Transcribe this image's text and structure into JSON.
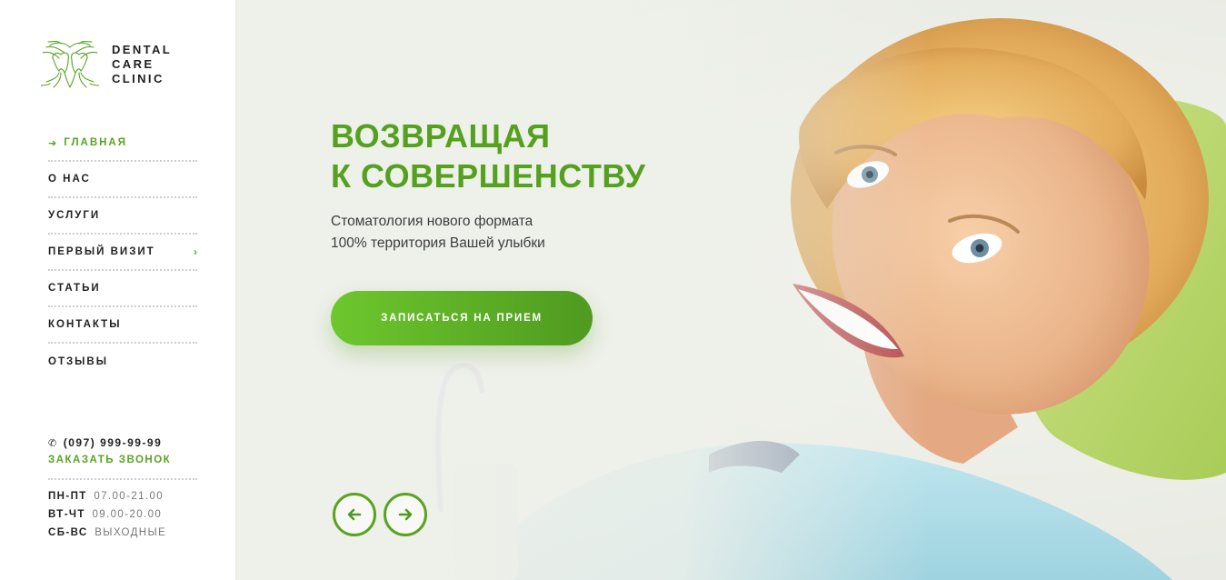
{
  "logo": {
    "line1": "DENTAL",
    "line2": "CARE",
    "line3": "CLINIC",
    "icon": "tree-teeth-logo"
  },
  "nav": {
    "items": [
      {
        "label": "ГЛАВНАЯ",
        "active": true,
        "icon": "arrow-right-icon"
      },
      {
        "label": "О НАС"
      },
      {
        "label": "УСЛУГИ"
      },
      {
        "label": "ПЕРВЫЙ ВИЗИТ",
        "icon": "chevron-right-icon",
        "chevron": "›"
      },
      {
        "label": "СТАТЬИ"
      },
      {
        "label": "КОНТАКТЫ"
      },
      {
        "label": "ОТЗЫВЫ"
      }
    ],
    "active_arrow": "➜"
  },
  "contacts": {
    "phone": "(097) 999-99-99",
    "callback": "ЗАКАЗАТЬ ЗВОНОК",
    "hours": [
      {
        "days": "ПН-ПТ",
        "time": "07.00-21.00"
      },
      {
        "days": "ВТ-ЧТ",
        "time": "09.00-20.00"
      },
      {
        "days": "СБ-ВС",
        "time": "ВЫХОДНЫЕ"
      }
    ]
  },
  "hero": {
    "title_line1": "ВОЗВРАЩАЯ",
    "title_line2": "К СОВЕРШЕНСТВУ",
    "subtitle_line1": "Стоматология нового формата",
    "subtitle_line2": "100% территория Вашей улыбки",
    "cta": "ЗАПИСАТЬСЯ НА ПРИЕМ"
  },
  "colors": {
    "accent": "#5aa321",
    "accent_light": "#6dc72d",
    "text": "#222222",
    "muted": "#777777"
  }
}
